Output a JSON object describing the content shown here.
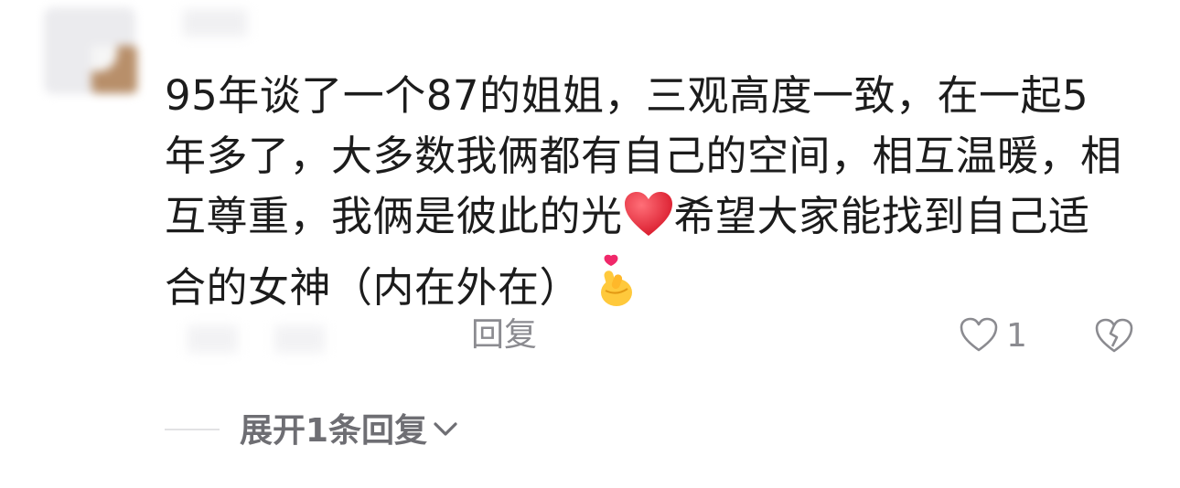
{
  "comment": {
    "line1": "95年谈了一个87的姐姐，三观高度一致，在一起5",
    "line2": "年多了，大多数我俩都有自己的空间，相互温暖，相",
    "line3a": "互尊重，我俩是彼此的光",
    "line3b": "希望大家能找到自己适",
    "line4": "合的女神（内在外在）",
    "emoji_heart": "red-heart-icon",
    "emoji_hand": "finger-heart-icon"
  },
  "actions": {
    "reply_label": "回复",
    "like_count": "1",
    "expand_label": "展开1条回复"
  },
  "colors": {
    "text": "#1c1c1c",
    "muted": "#8b8b90",
    "heart": "#e8303a"
  }
}
